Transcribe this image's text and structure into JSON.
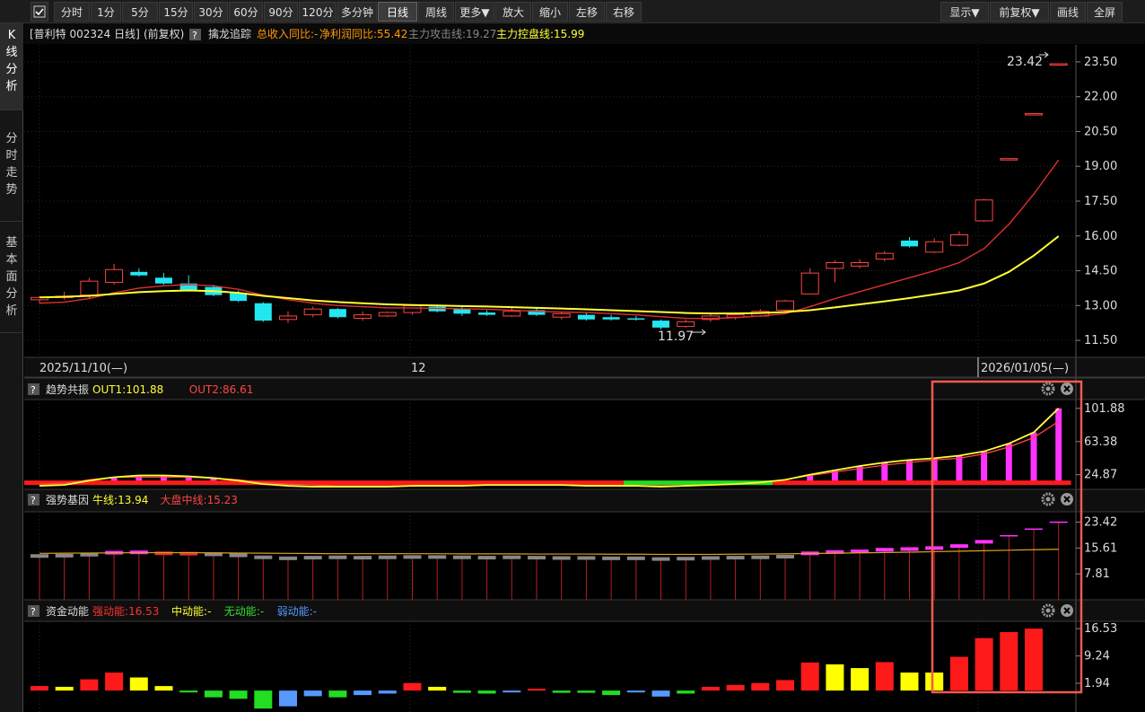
{
  "toolbar": {
    "periods": [
      "分时",
      "1分",
      "5分",
      "15分",
      "30分",
      "60分",
      "90分",
      "120分",
      "多分钟",
      "日线",
      "周线",
      "更多▼",
      "放大",
      "缩小",
      "左移",
      "右移"
    ],
    "active": "日线",
    "right": [
      "显示▼",
      "前复权▼",
      "画线",
      "全屏"
    ]
  },
  "sidebar": [
    {
      "label": "K线分析",
      "active": true
    },
    {
      "label": "分时走势",
      "active": false
    },
    {
      "label": "基本面分析",
      "active": false
    }
  ],
  "header": {
    "stock": "[普利特 002324 日线]",
    "adjust": "(前复权)",
    "help": "?",
    "indicator": "擒龙追踪",
    "rev": "总收入同比:-",
    "profit": "净利润同比:55.42",
    "attack": "主力攻击线:19.27",
    "control": "主力控盘线:15.99"
  },
  "colors": {
    "up": "#ff4444",
    "down": "#22e6f0",
    "ma_fast": "#e03030",
    "ma_slow": "#ffff33",
    "magenta": "#ff33ff",
    "highlight": "#f05a50"
  },
  "chart_data": [
    {
      "type": "candlestick",
      "title": "擒龙追踪",
      "ylim": [
        11.0,
        24.0
      ],
      "y_ticks": [
        "23.50",
        "22.00",
        "20.50",
        "19.00",
        "17.50",
        "16.00",
        "14.50",
        "13.00",
        "11.50"
      ],
      "x_labels": [
        "2025/11/10(—)",
        "12",
        "2026/01/05(—)"
      ],
      "annotations": {
        "high": "23.42",
        "low": "11.97"
      },
      "candles": [
        {
          "o": 13.25,
          "h": 13.4,
          "l": 13.1,
          "c": 13.35
        },
        {
          "o": 13.35,
          "h": 13.6,
          "l": 13.25,
          "c": 13.4
        },
        {
          "o": 13.45,
          "h": 14.2,
          "l": 13.3,
          "c": 14.05
        },
        {
          "o": 14.0,
          "h": 14.8,
          "l": 13.9,
          "c": 14.55
        },
        {
          "o": 14.45,
          "h": 14.6,
          "l": 14.25,
          "c": 14.3
        },
        {
          "o": 14.2,
          "h": 14.4,
          "l": 13.9,
          "c": 13.95
        },
        {
          "o": 13.95,
          "h": 14.3,
          "l": 13.6,
          "c": 13.65
        },
        {
          "o": 13.8,
          "h": 13.9,
          "l": 13.4,
          "c": 13.45
        },
        {
          "o": 13.55,
          "h": 13.65,
          "l": 13.15,
          "c": 13.2
        },
        {
          "o": 13.1,
          "h": 13.15,
          "l": 12.3,
          "c": 12.35
        },
        {
          "o": 12.4,
          "h": 12.75,
          "l": 12.25,
          "c": 12.55
        },
        {
          "o": 12.6,
          "h": 12.95,
          "l": 12.5,
          "c": 12.85
        },
        {
          "o": 12.85,
          "h": 12.9,
          "l": 12.45,
          "c": 12.5
        },
        {
          "o": 12.45,
          "h": 12.75,
          "l": 12.35,
          "c": 12.6
        },
        {
          "o": 12.55,
          "h": 12.75,
          "l": 12.5,
          "c": 12.7
        },
        {
          "o": 12.7,
          "h": 13.05,
          "l": 12.6,
          "c": 13.0
        },
        {
          "o": 12.95,
          "h": 13.05,
          "l": 12.7,
          "c": 12.75
        },
        {
          "o": 12.85,
          "h": 12.95,
          "l": 12.55,
          "c": 12.65
        },
        {
          "o": 12.7,
          "h": 12.8,
          "l": 12.55,
          "c": 12.6
        },
        {
          "o": 12.55,
          "h": 12.9,
          "l": 12.5,
          "c": 12.75
        },
        {
          "o": 12.8,
          "h": 12.9,
          "l": 12.55,
          "c": 12.6
        },
        {
          "o": 12.5,
          "h": 12.7,
          "l": 12.4,
          "c": 12.65
        },
        {
          "o": 12.6,
          "h": 12.7,
          "l": 12.35,
          "c": 12.4
        },
        {
          "o": 12.5,
          "h": 12.6,
          "l": 12.35,
          "c": 12.4
        },
        {
          "o": 12.45,
          "h": 12.55,
          "l": 12.35,
          "c": 12.4
        },
        {
          "o": 12.35,
          "h": 12.4,
          "l": 11.97,
          "c": 12.05
        },
        {
          "o": 12.1,
          "h": 12.4,
          "l": 12.05,
          "c": 12.3
        },
        {
          "o": 12.4,
          "h": 12.65,
          "l": 12.3,
          "c": 12.55
        },
        {
          "o": 12.5,
          "h": 12.7,
          "l": 12.4,
          "c": 12.6
        },
        {
          "o": 12.55,
          "h": 12.85,
          "l": 12.5,
          "c": 12.75
        },
        {
          "o": 12.8,
          "h": 13.25,
          "l": 12.7,
          "c": 13.2
        },
        {
          "o": 13.5,
          "h": 14.6,
          "l": 13.5,
          "c": 14.4
        },
        {
          "o": 14.6,
          "h": 14.95,
          "l": 14.0,
          "c": 14.85
        },
        {
          "o": 14.7,
          "h": 15.0,
          "l": 14.6,
          "c": 14.85
        },
        {
          "o": 15.0,
          "h": 15.35,
          "l": 14.9,
          "c": 15.25
        },
        {
          "o": 15.8,
          "h": 15.95,
          "l": 15.5,
          "c": 15.55
        },
        {
          "o": 15.3,
          "h": 15.9,
          "l": 15.25,
          "c": 15.75
        },
        {
          "o": 15.6,
          "h": 16.2,
          "l": 15.55,
          "c": 16.05
        },
        {
          "o": 16.65,
          "h": 17.6,
          "l": 16.6,
          "c": 17.55
        },
        {
          "o": 19.33,
          "h": 19.33,
          "l": 19.33,
          "c": 19.33
        },
        {
          "o": 21.27,
          "h": 21.27,
          "l": 21.27,
          "c": 21.27
        },
        {
          "o": 23.42,
          "h": 23.42,
          "l": 23.42,
          "c": 23.42
        }
      ],
      "ma_fast": [
        13.1,
        13.15,
        13.3,
        13.55,
        13.75,
        13.85,
        13.9,
        13.85,
        13.7,
        13.45,
        13.25,
        13.1,
        13.0,
        12.95,
        12.9,
        12.9,
        12.88,
        12.86,
        12.84,
        12.8,
        12.75,
        12.72,
        12.7,
        12.65,
        12.6,
        12.52,
        12.45,
        12.44,
        12.48,
        12.55,
        12.65,
        12.95,
        13.3,
        13.6,
        13.9,
        14.2,
        14.5,
        14.85,
        15.45,
        16.5,
        17.8,
        19.27
      ],
      "ma_slow": [
        13.35,
        13.38,
        13.42,
        13.5,
        13.58,
        13.62,
        13.65,
        13.62,
        13.55,
        13.42,
        13.32,
        13.22,
        13.15,
        13.1,
        13.05,
        13.02,
        13.0,
        12.98,
        12.96,
        12.93,
        12.9,
        12.87,
        12.84,
        12.8,
        12.76,
        12.72,
        12.68,
        12.66,
        12.66,
        12.68,
        12.72,
        12.8,
        12.92,
        13.05,
        13.18,
        13.32,
        13.48,
        13.65,
        13.95,
        14.45,
        15.15,
        15.99
      ]
    },
    {
      "type": "bar",
      "title": "趋势共振",
      "series": [
        {
          "name": "OUT1",
          "last": "101.88"
        },
        {
          "name": "OUT2",
          "last": "86.61"
        }
      ],
      "ylim": [
        10.0,
        110.0
      ],
      "y_ticks": [
        "101.88",
        "63.38",
        "24.87"
      ],
      "baseline": 15.0,
      "segments": [
        {
          "from": 0,
          "to": 23,
          "color": "red"
        },
        {
          "from": 24,
          "to": 29,
          "color": "green"
        },
        {
          "from": 30,
          "to": 41,
          "color": "red"
        }
      ],
      "out1": [
        12,
        13,
        18,
        22,
        24,
        24,
        23,
        21,
        18,
        14,
        12,
        11,
        11,
        11,
        11,
        12,
        12,
        12,
        13,
        13,
        13,
        13,
        12,
        12,
        12,
        11,
        12,
        13,
        14,
        16,
        19,
        25,
        30,
        35,
        39,
        42,
        44,
        47,
        52,
        61,
        74,
        101.88
      ],
      "out2": [
        14,
        15,
        19,
        22,
        22,
        22,
        22,
        21,
        19,
        16,
        14,
        13,
        12,
        12,
        12,
        12,
        12,
        12,
        13,
        13,
        13,
        13,
        12,
        12,
        12,
        12,
        12,
        13,
        14,
        16,
        19,
        24,
        28,
        32,
        36,
        39,
        42,
        44,
        49,
        57,
        68,
        86.61
      ],
      "bars": [
        0,
        0,
        0,
        1,
        1,
        1,
        1,
        1,
        0,
        0,
        0,
        0,
        0,
        0,
        0,
        0,
        0,
        0,
        0,
        0,
        0,
        0,
        0,
        0,
        0,
        0,
        0,
        0,
        0,
        0,
        0,
        1,
        1,
        1,
        1,
        1,
        1,
        1,
        1,
        1,
        1,
        1
      ]
    },
    {
      "type": "bar",
      "title": "强势基因",
      "series": [
        {
          "name": "牛线",
          "last": "13.94"
        },
        {
          "name": "大盘中线",
          "last": "15.23"
        }
      ],
      "ylim": [
        0.0,
        26.0
      ],
      "y_ticks": [
        "23.42",
        "15.61",
        "7.81"
      ],
      "niu": [
        13.2,
        13.3,
        13.6,
        14.2,
        14.3,
        14.0,
        13.9,
        13.7,
        13.4,
        12.8,
        12.5,
        12.7,
        12.8,
        12.7,
        12.8,
        12.9,
        12.9,
        12.8,
        12.7,
        12.8,
        12.7,
        12.6,
        12.6,
        12.5,
        12.5,
        12.3,
        12.4,
        12.6,
        12.7,
        12.8,
        13.0,
        14.0,
        14.4,
        14.6,
        15.1,
        15.3,
        15.6,
        16.2,
        17.5,
        19.3,
        21.3,
        23.4
      ],
      "kind": [
        "g",
        "g",
        "g",
        "m",
        "m",
        "r",
        "r",
        "g",
        "g",
        "g",
        "g",
        "g",
        "g",
        "g",
        "g",
        "g",
        "g",
        "g",
        "g",
        "g",
        "g",
        "g",
        "g",
        "g",
        "g",
        "g",
        "g",
        "g",
        "g",
        "g",
        "g",
        "m",
        "m",
        "m",
        "m",
        "m",
        "m",
        "m",
        "m",
        "m",
        "m",
        "m"
      ],
      "dapan": [
        14.0,
        14.05,
        14.1,
        14.15,
        14.2,
        14.2,
        14.2,
        14.15,
        14.1,
        14.05,
        14.0,
        13.95,
        13.9,
        13.9,
        13.9,
        13.9,
        13.9,
        13.85,
        13.85,
        13.85,
        13.8,
        13.8,
        13.8,
        13.75,
        13.75,
        13.7,
        13.7,
        13.7,
        13.75,
        13.8,
        13.85,
        13.95,
        14.05,
        14.15,
        14.25,
        14.35,
        14.5,
        14.65,
        14.8,
        14.95,
        15.1,
        15.23
      ]
    },
    {
      "type": "bar",
      "title": "资金动能",
      "series": [
        {
          "name": "强动能",
          "last": "16.53"
        },
        {
          "name": "中动能",
          "last": "-"
        },
        {
          "name": "无动能",
          "last": "-"
        },
        {
          "name": "弱动能",
          "last": "-"
        }
      ],
      "ylim": [
        -5.0,
        18.0
      ],
      "y_ticks": [
        "16.53",
        "9.24",
        "1.94"
      ],
      "values": [
        1.2,
        1.0,
        3.0,
        4.8,
        3.5,
        1.2,
        -0.5,
        -1.8,
        -2.2,
        -4.8,
        -4.2,
        -1.5,
        -1.8,
        -1.2,
        -0.8,
        2.0,
        1.0,
        -0.6,
        -0.8,
        -0.5,
        0.5,
        -0.6,
        -0.6,
        -1.2,
        -0.5,
        -1.6,
        -0.8,
        1.0,
        1.5,
        2.0,
        2.8,
        7.5,
        7.0,
        6.0,
        7.6,
        4.8,
        4.8,
        9.0,
        14.0,
        15.6,
        16.53,
        0
      ],
      "colors": [
        "r",
        "y",
        "r",
        "r",
        "y",
        "y",
        "g",
        "g",
        "g",
        "g",
        "b",
        "b",
        "g",
        "b",
        "b",
        "r",
        "y",
        "g",
        "g",
        "b",
        "r",
        "g",
        "g",
        "g",
        "b",
        "b",
        "g",
        "r",
        "r",
        "r",
        "r",
        "r",
        "y",
        "y",
        "r",
        "y",
        "y",
        "r",
        "r",
        "r",
        "r",
        "r"
      ]
    }
  ]
}
